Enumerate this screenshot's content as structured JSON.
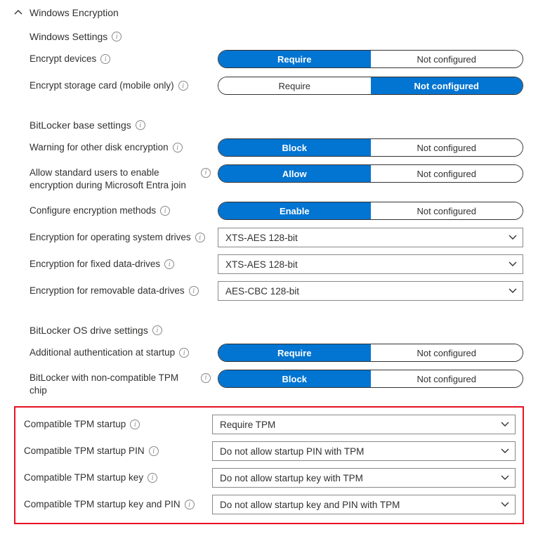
{
  "section": {
    "title": "Windows Encryption"
  },
  "group1": {
    "title": "Windows Settings",
    "rows": [
      {
        "id": "encrypt-devices",
        "label": "Encrypt devices",
        "left": "Require",
        "right": "Not configured",
        "active": "left"
      },
      {
        "id": "encrypt-storage",
        "label": "Encrypt storage card (mobile only)",
        "left": "Require",
        "right": "Not configured",
        "active": "right"
      }
    ]
  },
  "group2": {
    "title": "BitLocker base settings",
    "rows": [
      {
        "id": "warn-other-disk",
        "label": "Warning for other disk encryption",
        "left": "Block",
        "right": "Not configured",
        "active": "left"
      },
      {
        "id": "allow-std-users",
        "label": "Allow standard users to enable encryption during Microsoft Entra join",
        "left": "Allow",
        "right": "Not configured",
        "active": "left",
        "multi": true
      },
      {
        "id": "config-enc-methods",
        "label": "Configure encryption methods",
        "left": "Enable",
        "right": "Not configured",
        "active": "left"
      }
    ],
    "selects": [
      {
        "id": "enc-os-drives",
        "label": "Encryption for operating system drives",
        "value": "XTS-AES 128-bit"
      },
      {
        "id": "enc-fixed-drives",
        "label": "Encryption for fixed data-drives",
        "value": "XTS-AES 128-bit"
      },
      {
        "id": "enc-removable-drives",
        "label": "Encryption for removable data-drives",
        "value": "AES-CBC 128-bit"
      }
    ]
  },
  "group3": {
    "title": "BitLocker OS drive settings",
    "rows": [
      {
        "id": "add-auth-startup",
        "label": "Additional authentication at startup",
        "left": "Require",
        "right": "Not configured",
        "active": "left"
      },
      {
        "id": "noncompat-tpm",
        "label": "BitLocker with non-compatible TPM chip",
        "left": "Block",
        "right": "Not configured",
        "active": "left",
        "multi": true
      }
    ],
    "selects": [
      {
        "id": "tpm-startup",
        "label": "Compatible TPM startup",
        "value": "Require TPM"
      },
      {
        "id": "tpm-startup-pin",
        "label": "Compatible TPM startup PIN",
        "value": "Do not allow startup PIN with TPM"
      },
      {
        "id": "tpm-startup-key",
        "label": "Compatible TPM startup key",
        "value": "Do not allow startup key with TPM"
      },
      {
        "id": "tpm-startup-key-pin",
        "label": "Compatible TPM startup key and PIN",
        "value": "Do not allow startup key and PIN with TPM"
      }
    ]
  }
}
